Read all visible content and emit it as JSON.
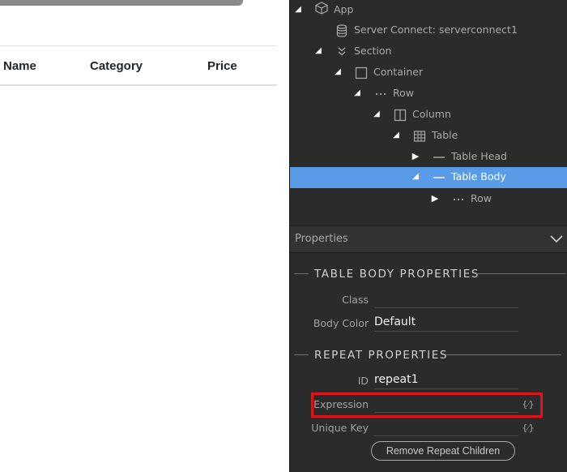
{
  "canvas": {
    "table_headers": [
      "Name",
      "Category",
      "Price"
    ]
  },
  "tree": {
    "items": [
      {
        "label": "App",
        "icon": "cube-icon"
      },
      {
        "label": "Server Connect: serverconnect1",
        "icon": "database-icon"
      },
      {
        "label": "Section",
        "icon": "section-icon"
      },
      {
        "label": "Container",
        "icon": "container-icon"
      },
      {
        "label": "Row",
        "icon": "row-icon"
      },
      {
        "label": "Column",
        "icon": "column-icon"
      },
      {
        "label": "Table",
        "icon": "table-icon"
      },
      {
        "label": "Table Head",
        "icon": "dash-icon"
      },
      {
        "label": "Table Body",
        "icon": "dash-icon",
        "selected": true
      },
      {
        "label": "Row",
        "icon": "row-icon"
      }
    ]
  },
  "properties": {
    "header_label": "Properties",
    "table_body_title": "TABLE BODY PROPERTIES",
    "class_label": "Class",
    "class_value": "",
    "body_color_label": "Body Color",
    "body_color_value": "Default",
    "repeat_title": "REPEAT PROPERTIES",
    "id_label": "ID",
    "id_value": "repeat1",
    "expression_label": "Expression",
    "expression_value": "",
    "unique_key_label": "Unique Key",
    "unique_key_value": "",
    "expr_button": "{⁄}",
    "remove_button": "Remove Repeat Children"
  },
  "colors": {
    "panel_bg": "#2b2b2b",
    "selected_bg": "#5a9be8",
    "highlight": "#e0131b"
  }
}
